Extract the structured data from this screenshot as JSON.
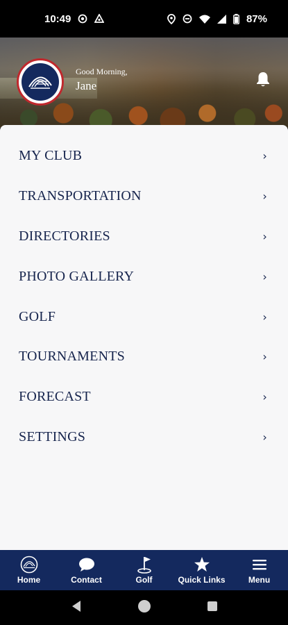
{
  "status_bar": {
    "time": "10:49",
    "battery": "87%",
    "left_icons": [
      "recording-icon",
      "vpn-icon"
    ],
    "right_icons": [
      "location-icon",
      "dnd-icon",
      "wifi-icon",
      "signal-icon",
      "battery-icon"
    ]
  },
  "header": {
    "greeting": "Good Morning,",
    "user_name": "Jane"
  },
  "menu": {
    "items": [
      {
        "label": "MY CLUB"
      },
      {
        "label": "TRANSPORTATION"
      },
      {
        "label": "DIRECTORIES"
      },
      {
        "label": "PHOTO GALLERY"
      },
      {
        "label": "GOLF"
      },
      {
        "label": "TOURNAMENTS"
      },
      {
        "label": "FORECAST"
      },
      {
        "label": "SETTINGS"
      }
    ],
    "chevron": "›"
  },
  "bottom_nav": {
    "items": [
      {
        "label": "Home",
        "icon": "club-logo-icon"
      },
      {
        "label": "Contact",
        "icon": "chat-bubble-icon"
      },
      {
        "label": "Golf",
        "icon": "golf-flag-icon"
      },
      {
        "label": "Quick Links",
        "icon": "star-icon"
      },
      {
        "label": "Menu",
        "icon": "hamburger-icon"
      }
    ]
  },
  "colors": {
    "brand_navy": "#14295e",
    "menu_text": "#16244d",
    "logo_border": "#c0282d"
  }
}
